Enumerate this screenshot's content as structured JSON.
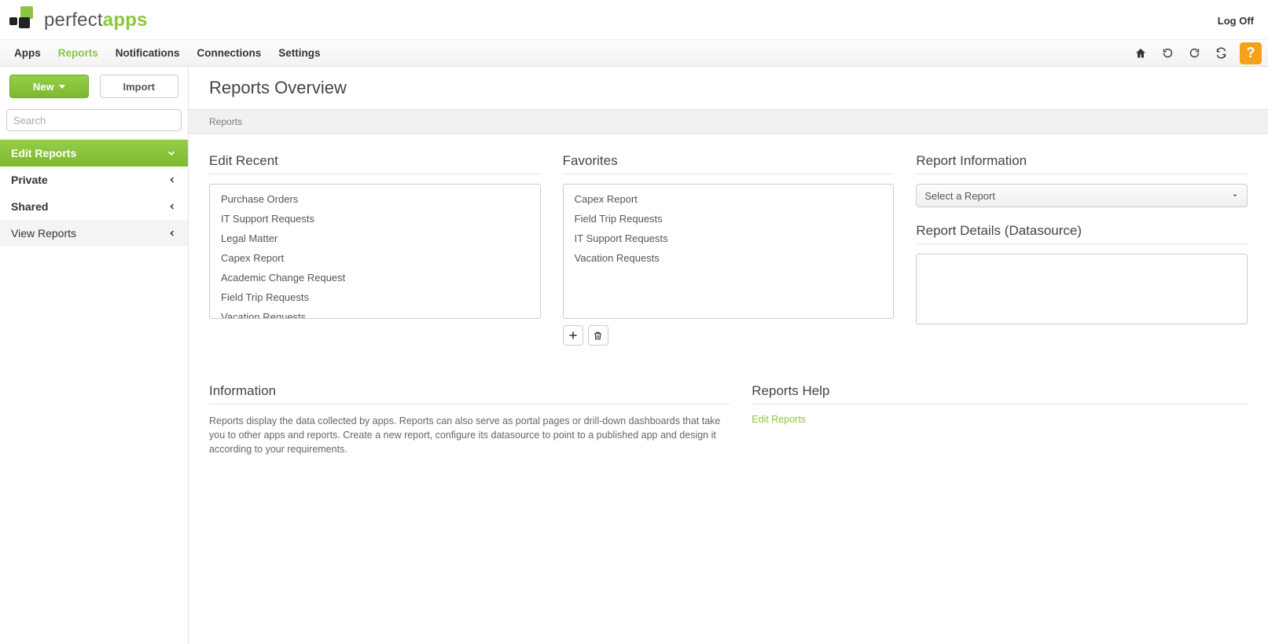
{
  "header": {
    "logo_text_a": "perfect",
    "logo_text_b": "apps",
    "logoff": "Log Off"
  },
  "nav": {
    "items": [
      {
        "label": "Apps"
      },
      {
        "label": "Reports"
      },
      {
        "label": "Notifications"
      },
      {
        "label": "Connections"
      },
      {
        "label": "Settings"
      }
    ]
  },
  "sidebar": {
    "new_label": "New",
    "import_label": "Import",
    "search_placeholder": "Search",
    "sections": [
      {
        "label": "Edit Reports"
      },
      {
        "label": "Private"
      },
      {
        "label": "Shared"
      },
      {
        "label": "View Reports"
      }
    ]
  },
  "page": {
    "title": "Reports Overview",
    "breadcrumb": "Reports"
  },
  "panels": {
    "edit_recent": {
      "heading": "Edit Recent",
      "items": [
        "Purchase Orders",
        "IT Support Requests",
        "Legal Matter",
        "Capex Report",
        "Academic Change Request",
        "Field Trip Requests",
        "Vacation Requests"
      ]
    },
    "favorites": {
      "heading": "Favorites",
      "items": [
        "Capex Report",
        "Field Trip Requests",
        "IT Support Requests",
        "Vacation Requests"
      ]
    },
    "report_info": {
      "heading": "Report Information",
      "select_placeholder": "Select a Report",
      "details_heading": "Report Details (Datasource)"
    }
  },
  "lower": {
    "info_heading": "Information",
    "info_text": "Reports display the data collected by apps. Reports can also serve as portal pages or drill-down dashboards that take you to other apps and reports. Create a new report, configure its datasource to point to a published app and design it according to your requirements.",
    "help_heading": "Reports Help",
    "help_link": "Edit Reports"
  }
}
